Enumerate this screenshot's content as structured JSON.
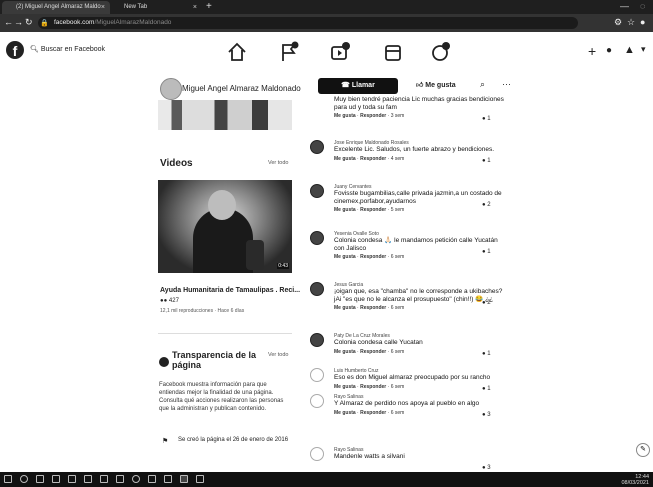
{
  "browser": {
    "tab1_title": "(2) Miguel Angel Almaraz Maldo",
    "tab2_title": "New Tab",
    "tab_close": "×",
    "new_tab": "+",
    "url_host": "facebook.com",
    "url_path": "/MiguelAlmarazMaldonado"
  },
  "fb": {
    "search_placeholder": "Buscar en Facebook",
    "page_name": "Miguel Angel Almaraz Maldonado",
    "call_label": "Llamar",
    "like_label": "Me gusta",
    "videos_title": "Videos",
    "see_all": "Ver todo",
    "video_title": "Ayuda Humanitaria de Tamaulipas . Reci...",
    "video_reacts": "427",
    "video_stats": "12,1 mil reproducciones · Hace 6 días",
    "video_time": "0:43",
    "transparency_title": "Transparencia de la página",
    "transparency_see_all": "Ver todo",
    "transparency_text": "Facebook muestra información para que entiendas mejor la finalidad de una página. Consulta qué acciones realizaron las personas que la administran y publican contenido.",
    "created_text": "Se creó la página el 26 de enero de 2016"
  },
  "comments": [
    {
      "name": "",
      "text": "Muy bien tendré paciencia Lic muchas gracias bendiciones para ud y toda su fam",
      "like": "Me gusta",
      "reply": "Responder",
      "time": "3 sem",
      "reacts": "1",
      "avatar": "hidden"
    },
    {
      "name": "Jose Enrique Maldonado Rosales",
      "text": "Excelente Lic. Saludos, un fuerte abrazo y bendiciones.",
      "like": "Me gusta",
      "reply": "Responder",
      "time": "4 sem",
      "reacts": "1",
      "avatar": "photo"
    },
    {
      "name": "Juany Cervantes",
      "text": "Fovisste bugambilias,calle privada jazmin,a un costado de cinemex,porfabor,ayudarnos",
      "like": "Me gusta",
      "reply": "Responder",
      "time": "5 sem",
      "reacts": "2",
      "avatar": "photo"
    },
    {
      "name": "Yesenia Ovalle Soto",
      "text": "Colonia condesa 🙏🏻 le mandamos petición calle Yucatán con Jalisco",
      "like": "Me gusta",
      "reply": "Responder",
      "time": "6 sem",
      "reacts": "1",
      "avatar": "photo"
    },
    {
      "name": "Jesus Garcia",
      "text": "¡oigan que, esa \"chamba\" no le corresponde a ukibaches? jAi \"es que no le alcanza el prosupuesto\" (chin!!) 😂 ¿¿",
      "like": "Me gusta",
      "reply": "Responder",
      "time": "6 sem",
      "reacts": "2",
      "avatar": "photo"
    },
    {
      "name": "Paty De La Cruz Morales",
      "text": "Colonia condesa calle Yucatan",
      "like": "Me gusta",
      "reply": "Responder",
      "time": "6 sem",
      "reacts": "1",
      "avatar": "photo"
    },
    {
      "name": "Luis Humberto Cruz",
      "text": "Eso es don Miguel almaraz preocupado por su rancho",
      "like": "Me gusta",
      "reply": "Responder",
      "time": "6 sem",
      "reacts": "1",
      "avatar": "empty"
    },
    {
      "name": "Rayo Salinas",
      "text": "Y Almaraz de perdido nos apoya al pueblo en algo",
      "like": "Me gusta",
      "reply": "Responder",
      "time": "6 sem",
      "reacts": "3",
      "avatar": "empty"
    },
    {
      "name": "Rayo Salinas",
      "text": "Mandenle watts a silvani",
      "like": "",
      "reply": "",
      "time": "",
      "reacts": "3",
      "avatar": "empty"
    }
  ],
  "taskbar": {
    "time": "12:44",
    "date": "08/03/2021"
  }
}
